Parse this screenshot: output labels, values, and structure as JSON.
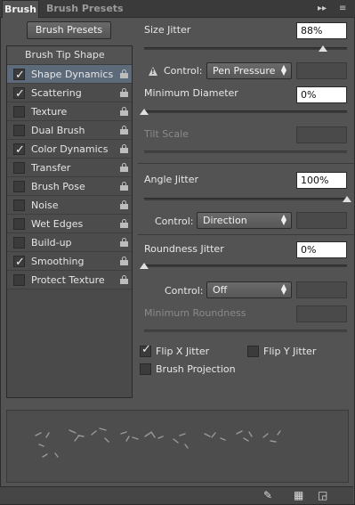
{
  "tabs": {
    "active": "Brush",
    "inactive": "Brush Presets"
  },
  "panel_menu": {
    "collapse_icon": "double-arrow-icon",
    "menu_icon": "panel-menu-icon"
  },
  "brush_presets_button": "Brush Presets",
  "brush_tip_shape": "Brush Tip Shape",
  "options": [
    {
      "label": "Shape Dynamics",
      "checked": true,
      "selected": true
    },
    {
      "label": "Scattering",
      "checked": true,
      "selected": false
    },
    {
      "label": "Texture",
      "checked": false,
      "selected": false
    },
    {
      "label": "Dual Brush",
      "checked": false,
      "selected": false
    },
    {
      "label": "Color Dynamics",
      "checked": true,
      "selected": false
    },
    {
      "label": "Transfer",
      "checked": false,
      "selected": false
    },
    {
      "label": "Brush Pose",
      "checked": false,
      "selected": false
    },
    {
      "label": "Noise",
      "checked": false,
      "selected": false
    },
    {
      "label": "Wet Edges",
      "checked": false,
      "selected": false
    },
    {
      "label": "Build-up",
      "checked": false,
      "selected": false
    },
    {
      "label": "Smoothing",
      "checked": true,
      "selected": false
    },
    {
      "label": "Protect Texture",
      "checked": false,
      "selected": false
    }
  ],
  "size_jitter": {
    "label": "Size Jitter",
    "value": "88%",
    "level": 0.88
  },
  "control_1": {
    "label": "Control:",
    "value": "Pen Pressure"
  },
  "minimum_diameter": {
    "label": "Minimum Diameter",
    "value": "0%",
    "level": 0.0
  },
  "tilt_scale": {
    "label": "Tilt Scale"
  },
  "angle_jitter": {
    "label": "Angle Jitter",
    "value": "100%",
    "level": 1.0
  },
  "control_2": {
    "label": "Control:",
    "value": "Direction"
  },
  "roundness_jitter": {
    "label": "Roundness Jitter",
    "value": "0%",
    "level": 0.0
  },
  "control_3": {
    "label": "Control:",
    "value": "Off"
  },
  "minimum_roundness": {
    "label": "Minimum Roundness"
  },
  "flip_x": {
    "label": "Flip X Jitter",
    "checked": true
  },
  "flip_y": {
    "label": "Flip Y Jitter",
    "checked": false
  },
  "brush_projection": {
    "label": "Brush Projection",
    "checked": false
  },
  "bottom_icons": [
    "toggle-brush-panel-icon",
    "grid-icon",
    "new-preset-icon"
  ]
}
